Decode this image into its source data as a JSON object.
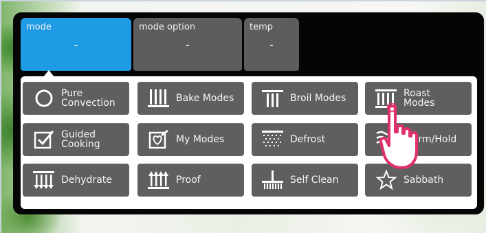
{
  "tabs": [
    {
      "label": "mode",
      "value": "-",
      "active": true
    },
    {
      "label": "mode option",
      "value": "-",
      "active": false
    },
    {
      "label": "temp",
      "value": "-",
      "active": false
    }
  ],
  "modes": [
    {
      "label": "Pure\nConvection",
      "icon": "circle-icon"
    },
    {
      "label": "Bake Modes",
      "icon": "bake-icon"
    },
    {
      "label": "Broil Modes",
      "icon": "broil-icon"
    },
    {
      "label": "Roast\nModes",
      "icon": "roast-icon"
    },
    {
      "label": "Guided\nCooking",
      "icon": "guided-cooking-icon"
    },
    {
      "label": "My Modes",
      "icon": "heart-box-icon"
    },
    {
      "label": "Defrost",
      "icon": "defrost-icon"
    },
    {
      "label": "Warm/Hold",
      "icon": "warm-hold-icon"
    },
    {
      "label": "Dehydrate",
      "icon": "dehydrate-icon"
    },
    {
      "label": "Proof",
      "icon": "proof-icon"
    },
    {
      "label": "Self Clean",
      "icon": "self-clean-icon"
    },
    {
      "label": "Sabbath",
      "icon": "star-icon"
    }
  ],
  "colors": {
    "active_tab": "#1e9be4",
    "button": "#5f5f5f",
    "hand": "#e0306a"
  }
}
